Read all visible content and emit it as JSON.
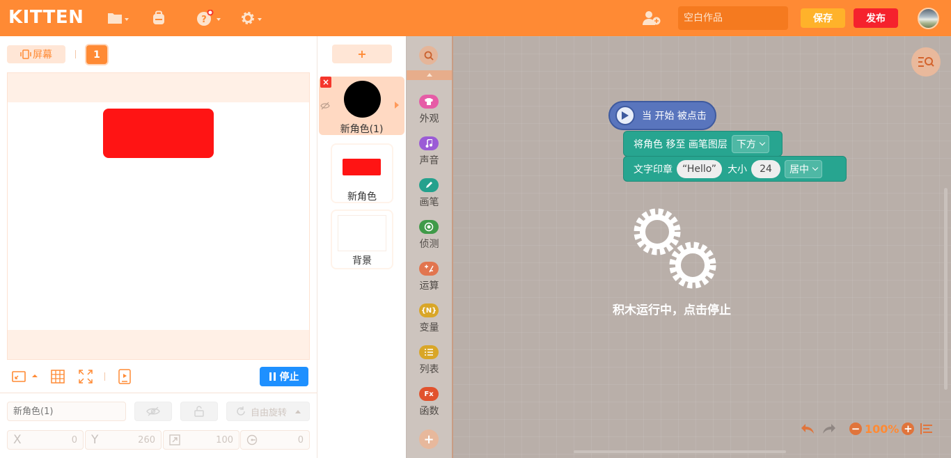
{
  "app": {
    "logo": "KITTEN"
  },
  "topbar": {
    "title_placeholder": "空白作品",
    "save_label": "保存",
    "publish_label": "发布",
    "accent": "#ff8a34"
  },
  "stage": {
    "screen_label": "屏幕",
    "page_number": "1",
    "stop_label": "停止",
    "sprite_name_placeholder": "新角色(1)",
    "rotation_label": "自由旋转",
    "x_label": "X",
    "x_value": "0",
    "y_label": "Y",
    "y_value": "260",
    "size_value": "100",
    "direction_value": "0"
  },
  "sprites": {
    "add_label": "+",
    "items": [
      {
        "name": "新角色(1)",
        "active": true
      },
      {
        "name": "新角色",
        "active": false
      },
      {
        "name": "背景",
        "active": false
      }
    ]
  },
  "categories": [
    {
      "label": "外观",
      "color": "#e65ca6",
      "glyph": ""
    },
    {
      "label": "声音",
      "color": "#9b5bd6",
      "glyph": ""
    },
    {
      "label": "画笔",
      "color": "#25a18d",
      "glyph": ""
    },
    {
      "label": "侦测",
      "color": "#3f9a48",
      "glyph": ""
    },
    {
      "label": "运算",
      "color": "#e2754f",
      "glyph": ""
    },
    {
      "label": "变量",
      "color": "#d9a627",
      "glyph": "{N}"
    },
    {
      "label": "列表",
      "color": "#d9a627",
      "glyph": ""
    },
    {
      "label": "函数",
      "color": "#e1522d",
      "glyph": "Fx"
    }
  ],
  "blocks": {
    "hat_label": "当 开始 被点击",
    "cmd1": {
      "text": "将角色 移至 画笔图层",
      "dropdown": "下方"
    },
    "cmd2": {
      "text": "文字印章",
      "string": "“Hello”",
      "size_label": "大小",
      "size": "24",
      "align": "居中"
    }
  },
  "workspace": {
    "running_text": "积木运行中，点击停止",
    "zoom": "100%"
  }
}
